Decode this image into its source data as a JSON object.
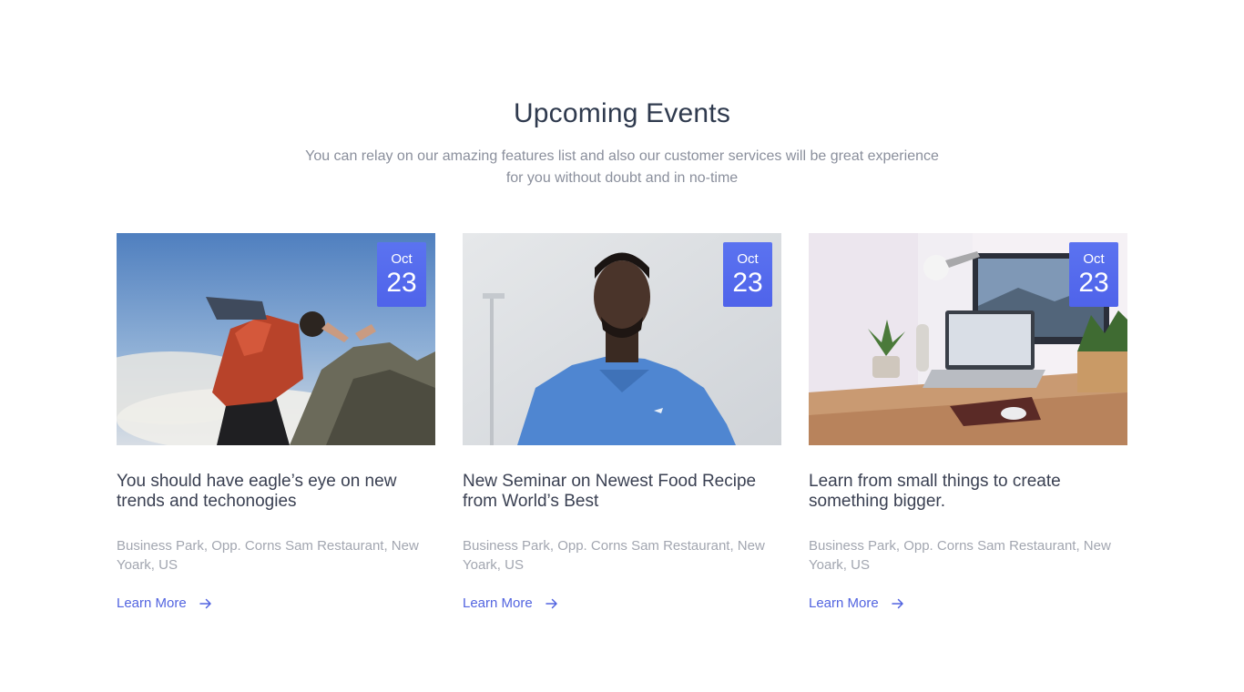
{
  "section": {
    "title": "Upcoming Events",
    "subtitle": "You can relay on our amazing features list and also our customer services will be great experience for you without doubt and in no-time"
  },
  "events": [
    {
      "month": "Oct",
      "day": "23",
      "title": "You should have eagle’s eye on new trends and techonogies",
      "address": "Business Park, Opp. Corns Sam Restaurant, New Yoark, US",
      "link_label": "Learn More",
      "image": "person-jumping-cliff-photo"
    },
    {
      "month": "Oct",
      "day": "23",
      "title": "New Seminar on Newest Food Recipe from World’s Best",
      "address": "Business Park, Opp. Corns Sam Restaurant, New Yoark, US",
      "link_label": "Learn More",
      "image": "man-blue-shirt-photo"
    },
    {
      "month": "Oct",
      "day": "23",
      "title": "Learn from small things to create something bigger.",
      "address": "Business Park, Opp. Corns Sam Restaurant, New Yoark, US",
      "link_label": "Learn More",
      "image": "desk-workspace-photo"
    }
  ],
  "colors": {
    "accent": "#5264e0",
    "badge": "#5b73f0",
    "heading": "#2f3a4e",
    "muted": "#8a8f9c"
  },
  "icons": {
    "link_arrow": "arrow-right-icon"
  }
}
